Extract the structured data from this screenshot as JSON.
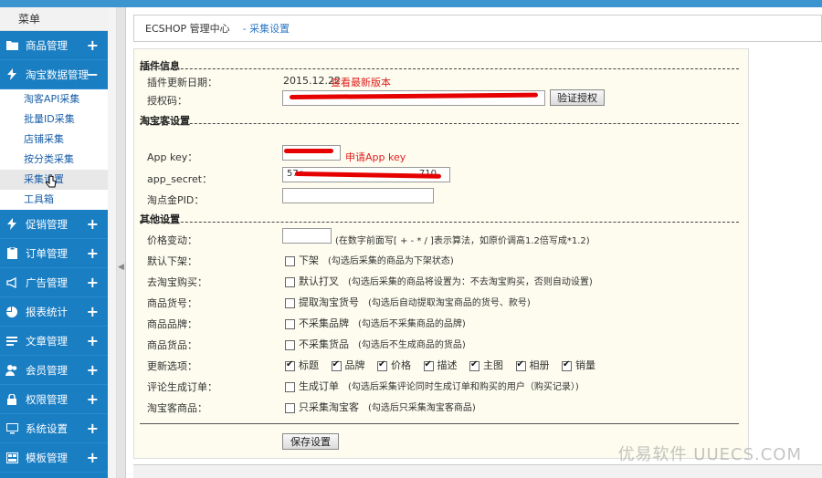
{
  "sidebar": {
    "title": "菜单",
    "categories": [
      {
        "label": "商品管理",
        "icon": "folder-icon",
        "toggle": "+"
      },
      {
        "label": "淘宝数据管理",
        "icon": "lightning-icon",
        "toggle": "−"
      }
    ],
    "subitems": [
      "淘客API采集",
      "批量ID采集",
      "店铺采集",
      "按分类采集",
      "采集设置",
      "工具箱"
    ],
    "categories_after": [
      {
        "label": "促销管理",
        "icon": "lightning-icon",
        "toggle": "+"
      },
      {
        "label": "订单管理",
        "icon": "clipboard-icon",
        "toggle": "+"
      },
      {
        "label": "广告管理",
        "icon": "megaphone-icon",
        "toggle": "+"
      },
      {
        "label": "报表统计",
        "icon": "pie-chart-icon",
        "toggle": "+"
      },
      {
        "label": "文章管理",
        "icon": "list-icon",
        "toggle": "+"
      },
      {
        "label": "会员管理",
        "icon": "users-icon",
        "toggle": "+"
      },
      {
        "label": "权限管理",
        "icon": "lock-icon",
        "toggle": "+"
      },
      {
        "label": "系统设置",
        "icon": "monitor-icon",
        "toggle": "+"
      },
      {
        "label": "模板管理",
        "icon": "template-icon",
        "toggle": "+"
      }
    ]
  },
  "breadcrumb": {
    "home": "ECSHOP 管理中心",
    "current": "- 采集设置"
  },
  "plugin": {
    "section": "插件信息",
    "update_label": "插件更新日期：",
    "update_date": "2015.12.22",
    "latest_link": "查看最新版本",
    "auth_label": "授权码：",
    "verify_button": "验证授权"
  },
  "taoke": {
    "section": "淘宝客设置",
    "appkey_label": "App key：",
    "appkey_link": "申请App key",
    "secret_label": "app_secret：",
    "secret_value": "57c",
    "secret_tail": "710",
    "pid_label": "淘点金PID："
  },
  "other": {
    "section": "其他设置",
    "price_label": "价格变动：",
    "price_hint": "(在数字前面写[ + - * / ]表示算法，如原价调高1.2倍写成*1.2)",
    "rows": [
      {
        "label": "默认下架：",
        "option": "下架",
        "hint": "(勾选后采集的商品为下架状态)"
      },
      {
        "label": "去淘宝购买：",
        "option": "默认打叉",
        "hint": "(勾选后采集的商品将设置为：不去淘宝购买，否则自动设置)"
      },
      {
        "label": "商品货号：",
        "option": "提取淘宝货号",
        "hint": "(勾选后自动提取淘宝商品的货号、款号)"
      },
      {
        "label": "商品品牌：",
        "option": "不采集品牌",
        "hint": "(勾选后不采集商品的品牌)"
      },
      {
        "label": "商品货品：",
        "option": "不采集货品",
        "hint": "(勾选后不生成商品的货品)"
      }
    ],
    "update_label": "更新选项：",
    "update_options": [
      "标题",
      "品牌",
      "价格",
      "描述",
      "主图",
      "相册",
      "销量"
    ],
    "rows2": [
      {
        "label": "评论生成订单：",
        "option": "生成订单",
        "hint": "(勾选后采集评论同时生成订单和购买的用户（购买记录）)"
      },
      {
        "label": "淘宝客商品：",
        "option": "只采集淘宝客",
        "hint": "(勾选后只采集淘宝客商品)"
      }
    ],
    "save_button": "保存设置"
  },
  "watermark": "优易软件 UUECS.COM"
}
